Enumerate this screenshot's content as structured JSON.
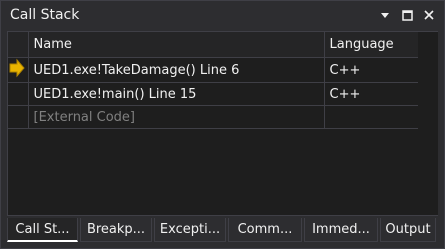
{
  "window": {
    "title": "Call Stack"
  },
  "title_controls": [
    {
      "name": "dropdown-arrow-icon",
      "glyph": "▾"
    },
    {
      "name": "maximize-icon",
      "glyph": "□"
    },
    {
      "name": "close-icon",
      "glyph": "✕"
    }
  ],
  "table": {
    "headers": {
      "name": "Name",
      "language": "Language"
    },
    "rows": [
      {
        "name": "UED1.exe!TakeDamage() Line 6",
        "language": "C++",
        "current": true
      },
      {
        "name": "UED1.exe!main() Line 15",
        "language": "C++",
        "current": false
      },
      {
        "name": "[External Code]",
        "language": "",
        "current": false
      }
    ]
  },
  "tabs": [
    {
      "label": "Call St...",
      "active": true
    },
    {
      "label": "Breakp...",
      "active": false
    },
    {
      "label": "Excepti...",
      "active": false
    },
    {
      "label": "Comm...",
      "active": false
    },
    {
      "label": "Immed...",
      "active": false
    },
    {
      "label": "Output",
      "active": false
    }
  ],
  "colors": {
    "accent_arrow": "#e8b400",
    "background": "#2d2d30",
    "grid": "#1e1e1e"
  }
}
